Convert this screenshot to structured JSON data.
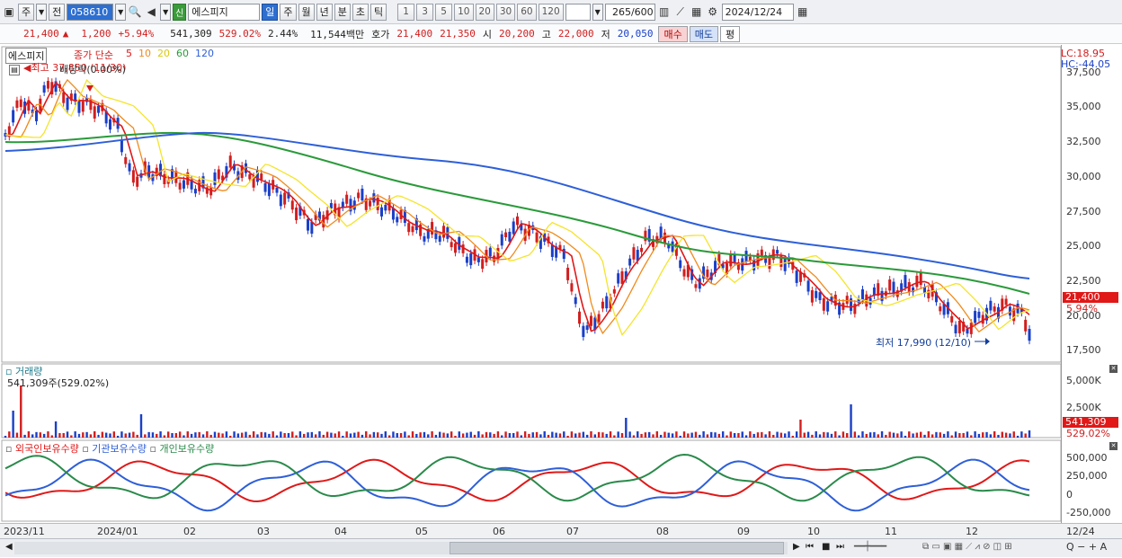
{
  "toolbar": {
    "type_btn": "주",
    "prev_btn": "전",
    "stock_code": "058610",
    "new_badge": "신",
    "stock_name": "에스피지",
    "periods": [
      "일",
      "주",
      "월",
      "년",
      "분",
      "초",
      "틱"
    ],
    "selected_period": "일",
    "intervals": [
      "1",
      "3",
      "5",
      "10",
      "20",
      "30",
      "60",
      "120"
    ],
    "count_display": "265",
    "count_max": "/600",
    "date": "2024/12/24"
  },
  "quote": {
    "price": "21,400",
    "arrow": "▲",
    "change": "1,200",
    "change_pct": "+5.94%",
    "volume": "541,309",
    "volume_ratio": "529.02%",
    "turnover_pct": "2.44%",
    "amount": "11,544백만",
    "hoga_label": "호가",
    "ask": "21,400",
    "bid": "21,350",
    "open_label": "시",
    "open": "20,200",
    "high_label": "고",
    "high": "22,000",
    "low_label": "저",
    "low": "20,050",
    "buy_btn": "매수",
    "sell_btn": "매도",
    "eval_btn": "평"
  },
  "price_panel": {
    "name_tag": "에스피지",
    "legend_main": "종가 단순",
    "ma_labels": [
      "5",
      "10",
      "20",
      "60",
      "120"
    ],
    "ma_colors": [
      "#e01818",
      "#f08a1c",
      "#f5e42a",
      "#2a9a3a",
      "#2e5fd8"
    ],
    "high_note": "최고 37,850 (11/30)",
    "div_note": "배당락(0.00%)",
    "low_note": "최저 17,990 (12/10)",
    "lc": "LC:18.95",
    "hc": "HC:-44.05",
    "y_labels": [
      "37,500",
      "35,000",
      "32,500",
      "30,000",
      "27,500",
      "25,000",
      "22,500",
      "20,000",
      "17,500"
    ],
    "last_price": "21,400",
    "last_pct": "5.94%"
  },
  "volume_panel": {
    "title": "거래량",
    "info": "541,309주(529.02%)",
    "y_labels": [
      "5,000K",
      "2,500K"
    ],
    "last_vol": "541,309",
    "last_pct": "529.02%"
  },
  "holdings_panel": {
    "legend": [
      "외국인보유수량",
      "기관보유수량",
      "개인보유수량"
    ],
    "colors": [
      "#e01818",
      "#2e5fd8",
      "#2a8a4a"
    ],
    "y_labels": [
      "500,000",
      "250,000",
      "0",
      "-250,000"
    ]
  },
  "x_axis": [
    "2023/11",
    "2024/01",
    "02",
    "03",
    "04",
    "05",
    "06",
    "07",
    "08",
    "09",
    "10",
    "11",
    "12",
    "12/24"
  ],
  "status_icons": [
    "play-icon",
    "first-icon",
    "stop-icon",
    "last-icon",
    "zoom-out-icon",
    "zoom-in-icon",
    "add-icon"
  ]
}
